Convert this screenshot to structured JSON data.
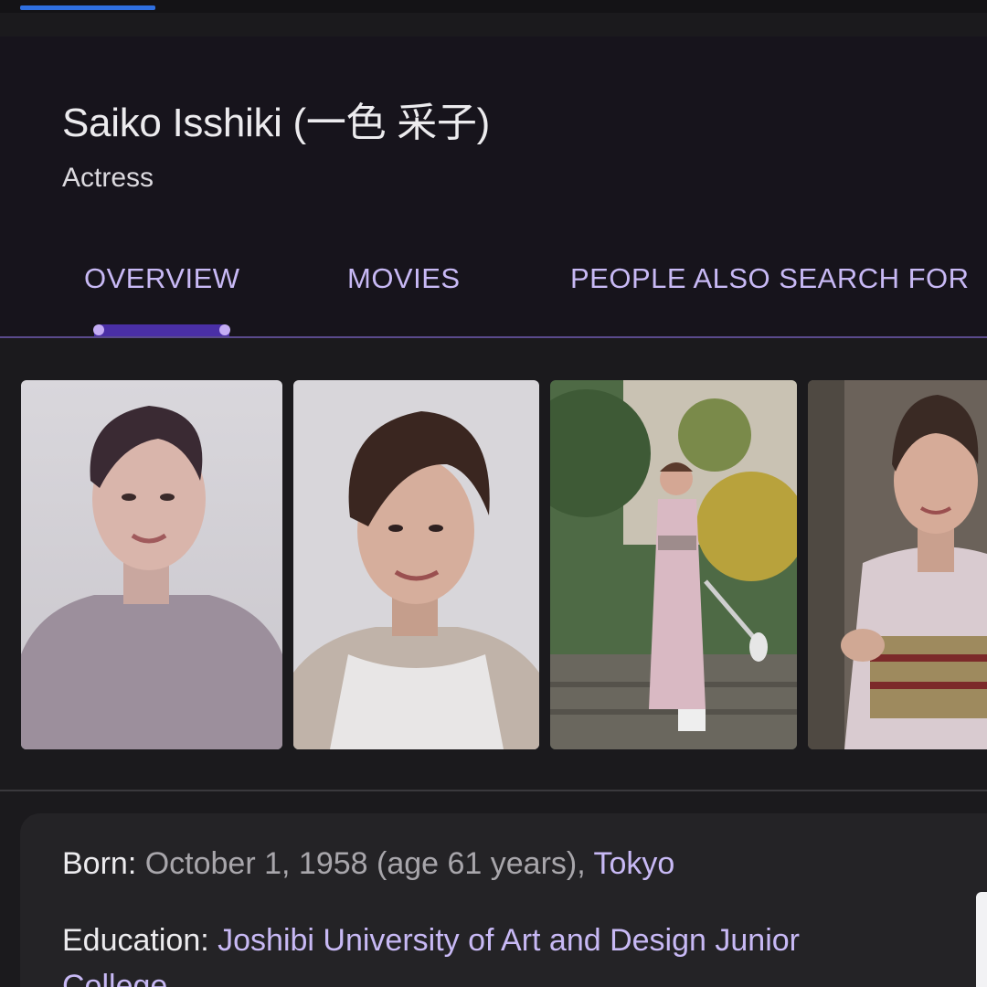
{
  "header": {
    "title": "Saiko Isshiki (一色 采子)",
    "subtitle": "Actress"
  },
  "tabs": [
    {
      "label": "OVERVIEW",
      "selected": true
    },
    {
      "label": "MOVIES",
      "selected": false
    },
    {
      "label": "PEOPLE ALSO SEARCH FOR",
      "selected": false
    }
  ],
  "photos": [
    {
      "subject": "portrait-gray-sweater"
    },
    {
      "subject": "portrait-white-top"
    },
    {
      "subject": "kimono-garden-stairs"
    },
    {
      "subject": "kimono-portrait-cropped"
    }
  ],
  "info": {
    "born": {
      "label": "Born:",
      "value": "October 1, 1958 (age 61 years),",
      "place": "Tokyo"
    },
    "education": {
      "label": "Education:",
      "value_line1": "Joshibi University of Art and Design Junior",
      "value_line2": "College"
    }
  },
  "colors": {
    "background": "#1b1a1d",
    "header_bg": "#17141c",
    "accent": "#c8b9f5",
    "indicator": "#4a2fa6",
    "progress": "#2f6fe0"
  }
}
